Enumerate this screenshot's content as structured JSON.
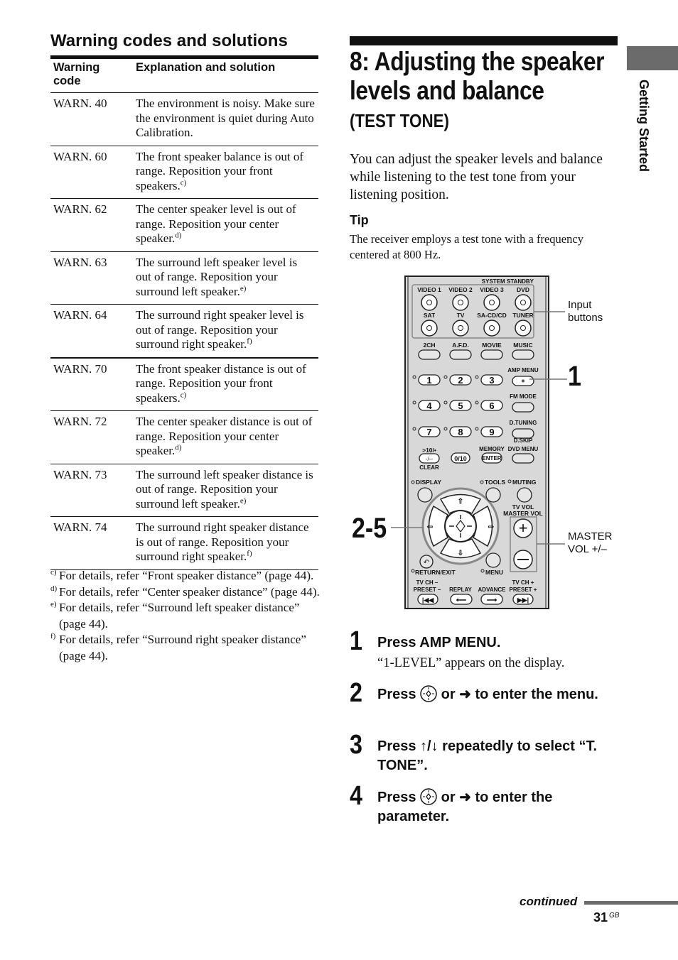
{
  "left": {
    "title": "Warning codes and solutions",
    "table": {
      "headers": [
        "Warning code",
        "Explanation and solution"
      ],
      "rows": [
        {
          "code": "WARN. 40",
          "text": "The environment is noisy. Make sure the environment is quiet during Auto Calibration.",
          "note": ""
        },
        {
          "code": "WARN. 60",
          "text": "The front speaker balance is out of range. Reposition your front speakers.",
          "note": "c)"
        },
        {
          "code": "WARN. 62",
          "text": "The center speaker level is out of range. Reposition your center speaker.",
          "note": "d)"
        },
        {
          "code": "WARN. 63",
          "text": "The surround left speaker level is out of range. Reposition your surround left speaker.",
          "note": "e)"
        },
        {
          "code": "WARN. 64",
          "text": "The surround right speaker level is out of range. Reposition your surround right speaker.",
          "note": "f)"
        },
        {
          "code": "WARN. 70",
          "text": "The front speaker distance is out of range. Reposition your front speakers.",
          "note": "c)"
        },
        {
          "code": "WARN. 72",
          "text": "The center speaker distance is out of range. Reposition your center speaker.",
          "note": "d)"
        },
        {
          "code": "WARN. 73",
          "text": "The surround left speaker distance is out of range. Reposition your surround left speaker.",
          "note": "e)"
        },
        {
          "code": "WARN. 74",
          "text": "The surround right speaker distance is out of range. Reposition your surround right speaker.",
          "note": "f)"
        }
      ]
    },
    "footnotes": [
      {
        "mark": "c)",
        "text": "For details, refer “Front speaker distance” (page 44)."
      },
      {
        "mark": "d)",
        "text": "For details, refer “Center speaker distance” (page 44)."
      },
      {
        "mark": "e)",
        "text": "For details, refer “Surround left speaker distance” (page 44)."
      },
      {
        "mark": "f)",
        "text": "For details, refer “Surround right speaker distance” (page 44)."
      }
    ]
  },
  "right": {
    "title": "8: Adjusting the speaker levels and balance",
    "subtitle": "(TEST TONE)",
    "intro": "You can adjust the speaker levels and balance while listening to the test tone from your listening position.",
    "tip_heading": "Tip",
    "tip_body": "The receiver employs a test tone with a frequency centered at 800 Hz."
  },
  "side_tab": {
    "label": "Getting Started",
    "color": "#6b6b6b"
  },
  "remote": {
    "system_standby": "SYSTEM STANDBY",
    "input_row1": [
      "VIDEO 1",
      "VIDEO 2",
      "VIDEO 3",
      "DVD"
    ],
    "input_row2": [
      "SAT",
      "TV",
      "SA-CD/CD",
      "TUNER"
    ],
    "mode_row": [
      "2CH",
      "A.F.D.",
      "MOVIE",
      "MUSIC"
    ],
    "numbers": [
      "1",
      "2",
      "3",
      "4",
      "5",
      "6",
      "7",
      "8",
      "9"
    ],
    "amp_menu": "AMP MENU",
    "fm_mode": "FM MODE",
    "d_tuning": "D.TUNING",
    "d_skip": "D.SKIP",
    "dvd_menu": "DVD MENU",
    "ten_label": ">10/•",
    "dash_key": "-/--",
    "clear": "CLEAR",
    "zero_key": "0/10",
    "memory": "MEMORY",
    "enter_key": "ENTER",
    "display": "DISPLAY",
    "tools": "TOOLS",
    "muting": "MUTING",
    "tv_vol": "TV VOL",
    "master_vol": "MASTER VOL",
    "return_exit": "RETURN/EXIT",
    "menu": "MENU",
    "tv_ch_minus": "TV CH –",
    "preset_minus": "PRESET –",
    "replay": "REPLAY",
    "advance": "ADVANCE",
    "tv_ch_plus": "TV CH +",
    "preset_plus": "PRESET +",
    "callouts": {
      "input_line1": "Input",
      "input_line2": "buttons",
      "master_line1": "MASTER",
      "master_line2": "VOL +/–",
      "step1": "1",
      "step25": "2-5"
    }
  },
  "steps": [
    {
      "num": "1",
      "pre": "Press AMP MENU.",
      "post": "",
      "note": "“1-LEVEL” appears on the display."
    },
    {
      "num": "2",
      "pre": "Press",
      "post": "or ➜ to enter the menu.",
      "note": ""
    },
    {
      "num": "3",
      "pre": "Press ↑/↓ repeatedly to select “T. TONE”.",
      "post": "",
      "note": ""
    },
    {
      "num": "4",
      "pre": "Press",
      "post": "or ➜ to enter the parameter.",
      "note": ""
    }
  ],
  "footer": {
    "continued": "continued",
    "page": "31",
    "page_suffix": "GB"
  }
}
